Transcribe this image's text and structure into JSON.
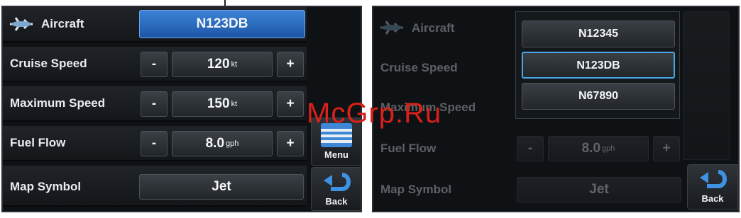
{
  "left": {
    "aircraft_label": "Aircraft",
    "aircraft_value": "N123DB",
    "rows": [
      {
        "label": "Cruise Speed",
        "minus": "-",
        "value": "120",
        "unit": "kt",
        "plus": "+"
      },
      {
        "label": "Maximum Speed",
        "minus": "-",
        "value": "150",
        "unit": "kt",
        "plus": "+"
      },
      {
        "label": "Fuel Flow",
        "minus": "-",
        "value": "8.0",
        "unit": "gph",
        "plus": "+"
      }
    ],
    "map_symbol_label": "Map Symbol",
    "map_symbol_value": "Jet",
    "menu_label": "Menu",
    "back_label": "Back"
  },
  "right": {
    "aircraft_label": "Aircraft",
    "cruise_label": "Cruise Speed",
    "max_label": "Maximum Speed",
    "fuel_label": "Fuel Flow",
    "fuel_minus": "-",
    "fuel_value": "8.0",
    "fuel_unit": "gph",
    "fuel_plus": "+",
    "map_symbol_label": "Map Symbol",
    "map_symbol_value": "Jet",
    "back_label": "Back",
    "popup_items": [
      "N12345",
      "N123DB",
      "N67890"
    ]
  },
  "watermark": "McGrp.Ru",
  "colors": {
    "accent": "#2a6cc4",
    "selection_outline": "#49a7e8",
    "watermark": "#d9201a"
  }
}
